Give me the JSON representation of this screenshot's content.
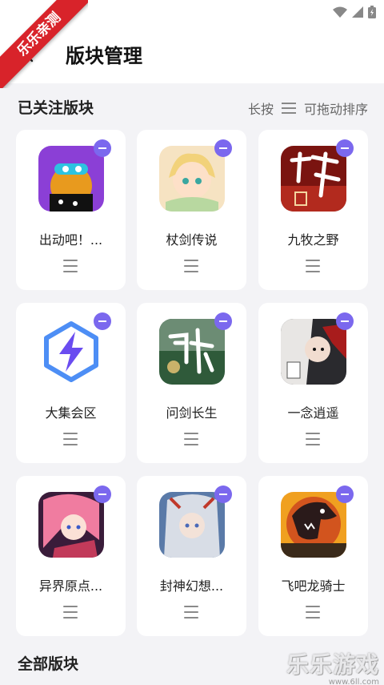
{
  "watermark_ribbon": "乐乐亲测",
  "header": {
    "title": "版块管理"
  },
  "followed": {
    "title": "已关注版块",
    "hint_left": "长按",
    "hint_right": "可拖动排序",
    "items": [
      {
        "name": "出动吧！...",
        "icon": "duck-game-icon",
        "color": "#8b3fd6"
      },
      {
        "name": "杖剑传说",
        "icon": "anime-girl-icon",
        "color": "#f0c89a"
      },
      {
        "name": "九牧之野",
        "icon": "calligraphy-icon",
        "color": "#b22a1e"
      },
      {
        "name": "大集会区",
        "icon": "lightning-hex-icon",
        "color": "#5a6cf5"
      },
      {
        "name": "问剑长生",
        "icon": "sword-calligraphy-icon",
        "color": "#2f5a3a"
      },
      {
        "name": "一念逍遥",
        "icon": "xianxia-hero-icon",
        "color": "#3a3a3a"
      },
      {
        "name": "异界原点...",
        "icon": "pink-hair-girl-icon",
        "color": "#c23a5a"
      },
      {
        "name": "封神幻想...",
        "icon": "silver-hair-hero-icon",
        "color": "#5a7aa8"
      },
      {
        "name": "飞吧龙骑士",
        "icon": "dragon-icon",
        "color": "#d2541e"
      }
    ]
  },
  "all": {
    "title": "全部版块"
  },
  "watermark": {
    "main": "乐乐游戏",
    "sub": "www.6ll.com"
  }
}
